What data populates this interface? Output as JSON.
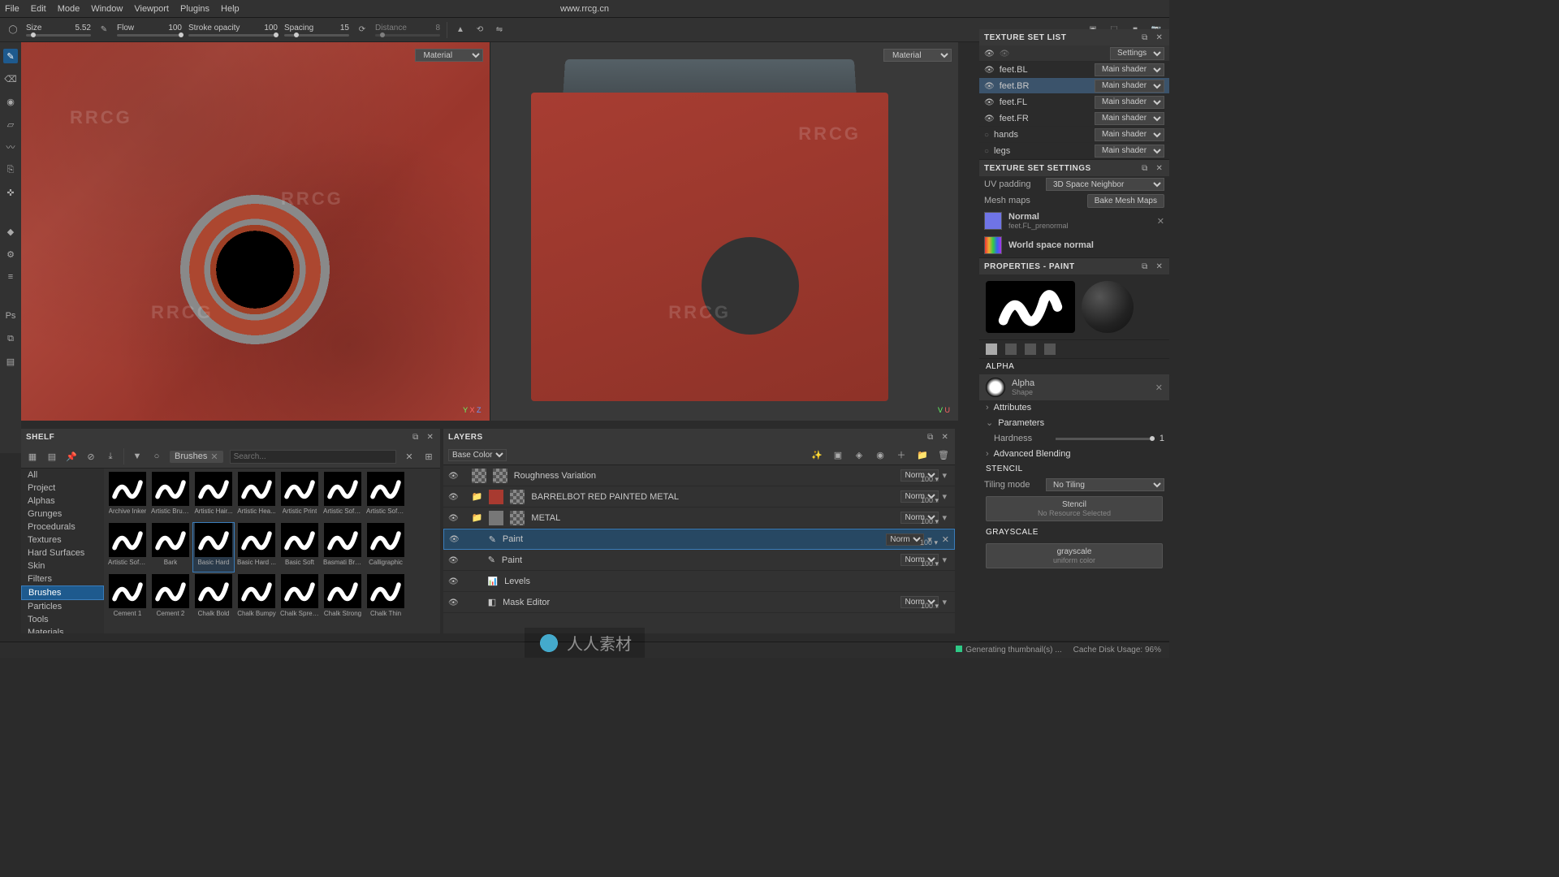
{
  "menubar": {
    "items": [
      "File",
      "Edit",
      "Mode",
      "Window",
      "Viewport",
      "Plugins",
      "Help"
    ],
    "url": "www.rrcg.cn"
  },
  "toolopts": {
    "size": {
      "label": "Size",
      "value": "5.52"
    },
    "flow": {
      "label": "Flow",
      "value": "100"
    },
    "stroke": {
      "label": "Stroke opacity",
      "value": "100"
    },
    "spacing": {
      "label": "Spacing",
      "value": "15"
    },
    "distance": {
      "label": "Distance",
      "value": "8"
    }
  },
  "viewport": {
    "material_label": "Material",
    "axes": [
      "X",
      "Y",
      "Z",
      "U",
      "V"
    ]
  },
  "watermark_text": "RRCG",
  "shelf": {
    "title": "SHELF",
    "filter_pill": "Brushes",
    "search_placeholder": "Search...",
    "categories": [
      "All",
      "Project",
      "Alphas",
      "Grunges",
      "Procedurals",
      "Textures",
      "Hard Surfaces",
      "Skin",
      "Filters",
      "Brushes",
      "Particles",
      "Tools",
      "Materials"
    ],
    "selected_category": "Brushes",
    "brushes": [
      "Archive Inker",
      "Artistic Brus...",
      "Artistic Hair...",
      "Artistic Hea...",
      "Artistic Print",
      "Artistic Soft ...",
      "Artistic Soft ...",
      "Artistic Soft ...",
      "Bark",
      "Basic Hard",
      "Basic Hard ...",
      "Basic Soft",
      "Basmati Bru...",
      "Calligraphic",
      "Cement 1",
      "Cement 2",
      "Chalk Bold",
      "Chalk Bumpy",
      "Chalk Spread",
      "Chalk Strong",
      "Chalk Thin"
    ],
    "selected_brush": "Basic Hard"
  },
  "layers": {
    "title": "LAYERS",
    "channel": "Base Color",
    "items": [
      {
        "name": "Roughness Variation",
        "blend": "Norm",
        "opacity": "100",
        "type": "layer",
        "indent": 0
      },
      {
        "name": "BARRELBOT RED PAINTED METAL",
        "blend": "Norm",
        "opacity": "100",
        "type": "folder",
        "indent": 0,
        "red": true
      },
      {
        "name": "METAL",
        "blend": "Norm",
        "opacity": "100",
        "type": "folder",
        "indent": 0,
        "grey": true
      },
      {
        "name": "Paint",
        "blend": "Norm",
        "opacity": "100",
        "type": "paint",
        "indent": 1,
        "selected": true
      },
      {
        "name": "Paint",
        "blend": "Norm",
        "opacity": "100",
        "type": "paint",
        "indent": 1
      },
      {
        "name": "Levels",
        "blend": "",
        "opacity": "",
        "type": "levels",
        "indent": 1
      },
      {
        "name": "Mask Editor",
        "blend": "Norm",
        "opacity": "100",
        "type": "mask",
        "indent": 1
      }
    ]
  },
  "textureSets": {
    "title": "TEXTURE SET LIST",
    "settings_label": "Settings",
    "shader_label": "Main shader",
    "items": [
      {
        "name": "feet.BL"
      },
      {
        "name": "feet.BR",
        "selected": true
      },
      {
        "name": "feet.FL"
      },
      {
        "name": "feet.FR"
      },
      {
        "name": "hands",
        "noeye": true
      },
      {
        "name": "legs",
        "noeye": true
      }
    ]
  },
  "textureSettings": {
    "title": "TEXTURE SET SETTINGS",
    "uvpadding_label": "UV padding",
    "uvpadding_value": "3D Space Neighbor",
    "meshmaps_label": "Mesh maps",
    "bake_label": "Bake Mesh Maps",
    "normal": {
      "label": "Normal",
      "sub": "feet.FL_prenormal"
    },
    "world_space": "World space normal"
  },
  "properties": {
    "title": "PROPERTIES - PAINT",
    "alpha_section": "ALPHA",
    "alpha_label": "Alpha",
    "alpha_sub": "Shape",
    "attributes": "Attributes",
    "parameters": "Parameters",
    "hardness_label": "Hardness",
    "hardness_value": "1",
    "adv_blending": "Advanced Blending",
    "stencil_section": "STENCIL",
    "tiling_label": "Tiling mode",
    "tiling_value": "No Tiling",
    "stencil_btn": "Stencil",
    "stencil_sub": "No Resource Selected",
    "grayscale_section": "GRAYSCALE",
    "grayscale_btn": "grayscale",
    "grayscale_sub": "uniform color"
  },
  "status": {
    "generating": "Generating thumbnail(s) ...",
    "cache": "Cache Disk Usage:",
    "cache_val": "96%"
  },
  "bottom_wm": "人人素材"
}
